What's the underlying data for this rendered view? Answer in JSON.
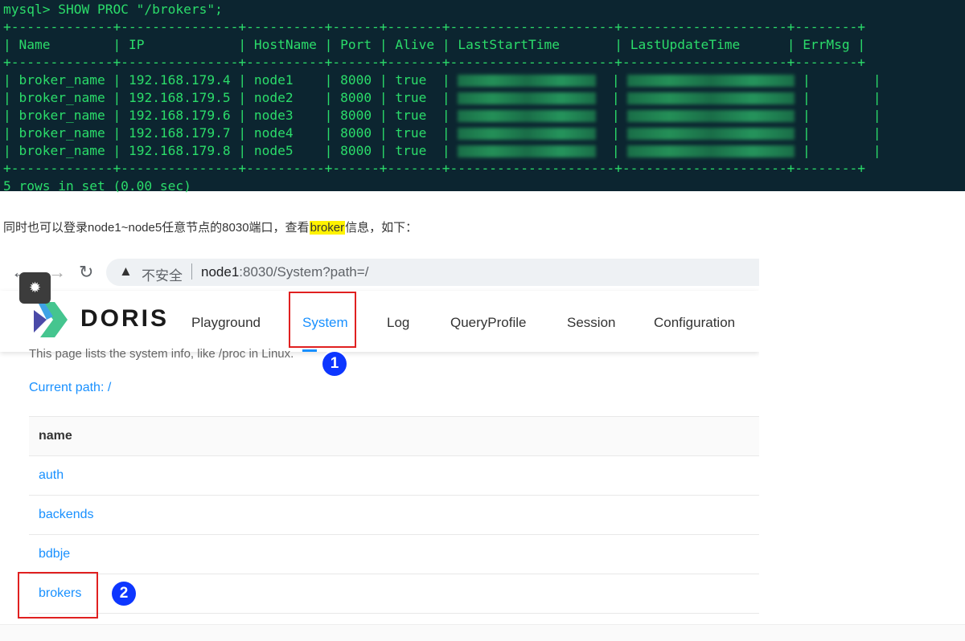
{
  "terminal": {
    "command": "mysql> SHOW PROC \"/brokers\";",
    "headers": [
      "Name",
      "IP",
      "HostName",
      "Port",
      "Alive",
      "LastStartTime",
      "LastUpdateTime",
      "ErrMsg"
    ],
    "rows": [
      {
        "name": "broker_name",
        "ip": "192.168.179.4",
        "host": "node1",
        "port": "8000",
        "alive": "true"
      },
      {
        "name": "broker_name",
        "ip": "192.168.179.5",
        "host": "node2",
        "port": "8000",
        "alive": "true"
      },
      {
        "name": "broker_name",
        "ip": "192.168.179.6",
        "host": "node3",
        "port": "8000",
        "alive": "true"
      },
      {
        "name": "broker_name",
        "ip": "192.168.179.7",
        "host": "node4",
        "port": "8000",
        "alive": "true"
      },
      {
        "name": "broker_name",
        "ip": "192.168.179.8",
        "host": "node5",
        "port": "8000",
        "alive": "true"
      }
    ],
    "footer": "5 rows in set (0.00 sec)"
  },
  "paragraph": {
    "before": "同时也可以登录node1~node5任意节点的8030端口，查看",
    "highlight": "broker",
    "after": "信息，如下："
  },
  "browser": {
    "insecure_label": "不安全",
    "url_host": "node1",
    "url_rest": ":8030/System?path=/",
    "brand": "DORIS",
    "nav": [
      "Playground",
      "System",
      "Log",
      "QueryProfile",
      "Session",
      "Configuration"
    ],
    "active_nav": "System",
    "cut_text": "This page lists the system info, like /proc in Linux.",
    "current_path": "Current path: /",
    "table_header": "name",
    "table_rows": [
      "auth",
      "backends",
      "bdbje",
      "brokers"
    ]
  },
  "badges": [
    "1",
    "2"
  ],
  "colors": {
    "terminal_bg": "#0c2530",
    "terminal_fg": "#2bdc6a",
    "link": "#1890ff",
    "highlight": "#fff200",
    "annotation_red": "#e02020",
    "badge_blue": "#0d36ff"
  }
}
